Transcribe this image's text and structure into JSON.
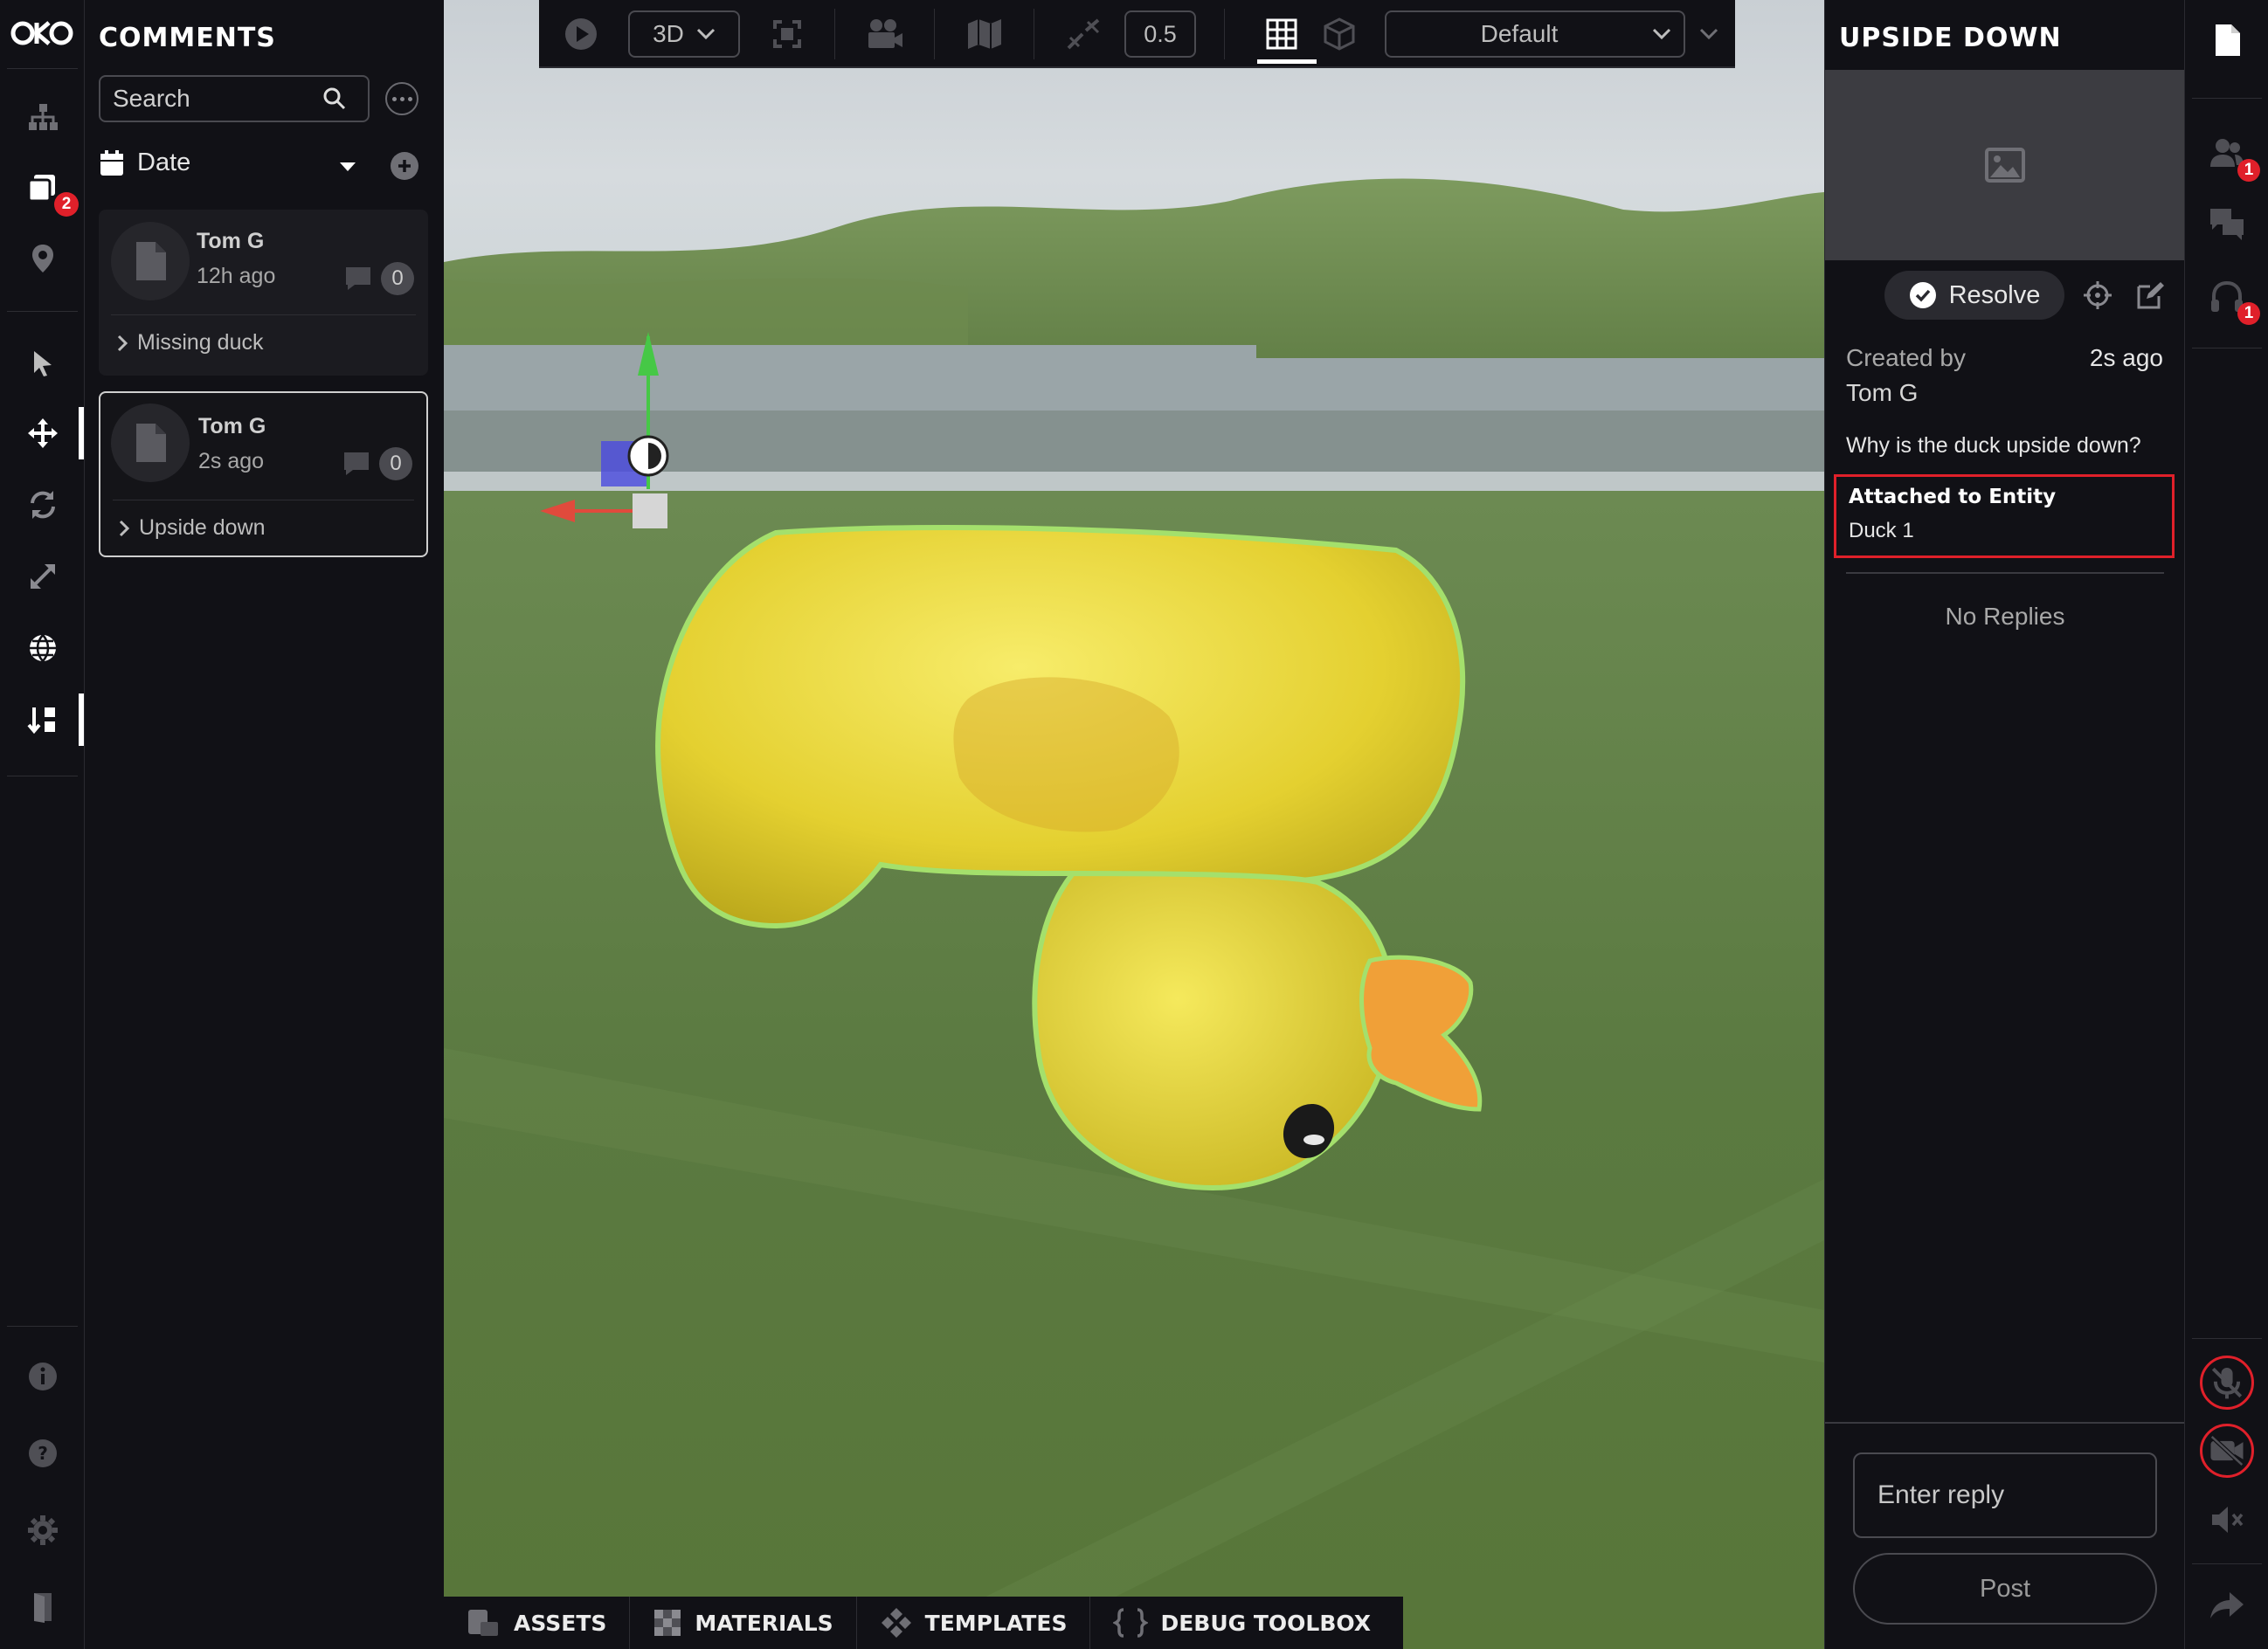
{
  "app": {
    "logo": "OKO"
  },
  "left_rail": {
    "items": [
      {
        "icon": "hierarchy-icon"
      },
      {
        "icon": "comments-icon",
        "badge": "2"
      },
      {
        "icon": "location-pin-icon"
      },
      {
        "icon": "cursor-select-icon"
      },
      {
        "icon": "move-icon",
        "active": true
      },
      {
        "icon": "rotate-icon"
      },
      {
        "icon": "scale-icon"
      },
      {
        "icon": "globe-icon"
      },
      {
        "icon": "sort-icon",
        "active": true
      },
      {
        "icon": "info-icon"
      },
      {
        "icon": "help-icon"
      },
      {
        "icon": "settings-icon"
      },
      {
        "icon": "exit-icon"
      }
    ]
  },
  "comments_panel": {
    "title": "COMMENTS",
    "search_placeholder": "Search",
    "sort_label": "Date",
    "comments": [
      {
        "author": "Tom G",
        "time": "12h ago",
        "replies": "0",
        "title": "Missing duck"
      },
      {
        "author": "Tom G",
        "time": "2s ago",
        "replies": "0",
        "title": "Upside down"
      }
    ]
  },
  "toolbar": {
    "view_mode": "3D",
    "snap_value": "0.5",
    "camera_preset": "Default"
  },
  "bottom_bar": {
    "tabs": [
      {
        "label": "ASSETS",
        "icon": "assets-icon"
      },
      {
        "label": "MATERIALS",
        "icon": "materials-icon"
      },
      {
        "label": "TEMPLATES",
        "icon": "templates-icon"
      },
      {
        "label": "DEBUG TOOLBOX",
        "icon": "code-braces-icon"
      }
    ]
  },
  "detail_panel": {
    "title": "UPSIDE DOWN",
    "resolve_label": "Resolve",
    "created_by_label": "Created by",
    "created_time": "2s ago",
    "author": "Tom G",
    "body": "Why is the duck upside down?",
    "attached_label": "Attached to Entity",
    "attached_entity": "Duck 1",
    "no_replies": "No Replies",
    "reply_placeholder": "Enter reply",
    "post_label": "Post"
  },
  "right_rail": {
    "users_badge": "1",
    "audio_badge": "1"
  },
  "colors": {
    "accent_red": "#e0202a",
    "panel_bg": "#111116",
    "selection_green": "#9be564",
    "duck_yellow": "#e8d936"
  }
}
